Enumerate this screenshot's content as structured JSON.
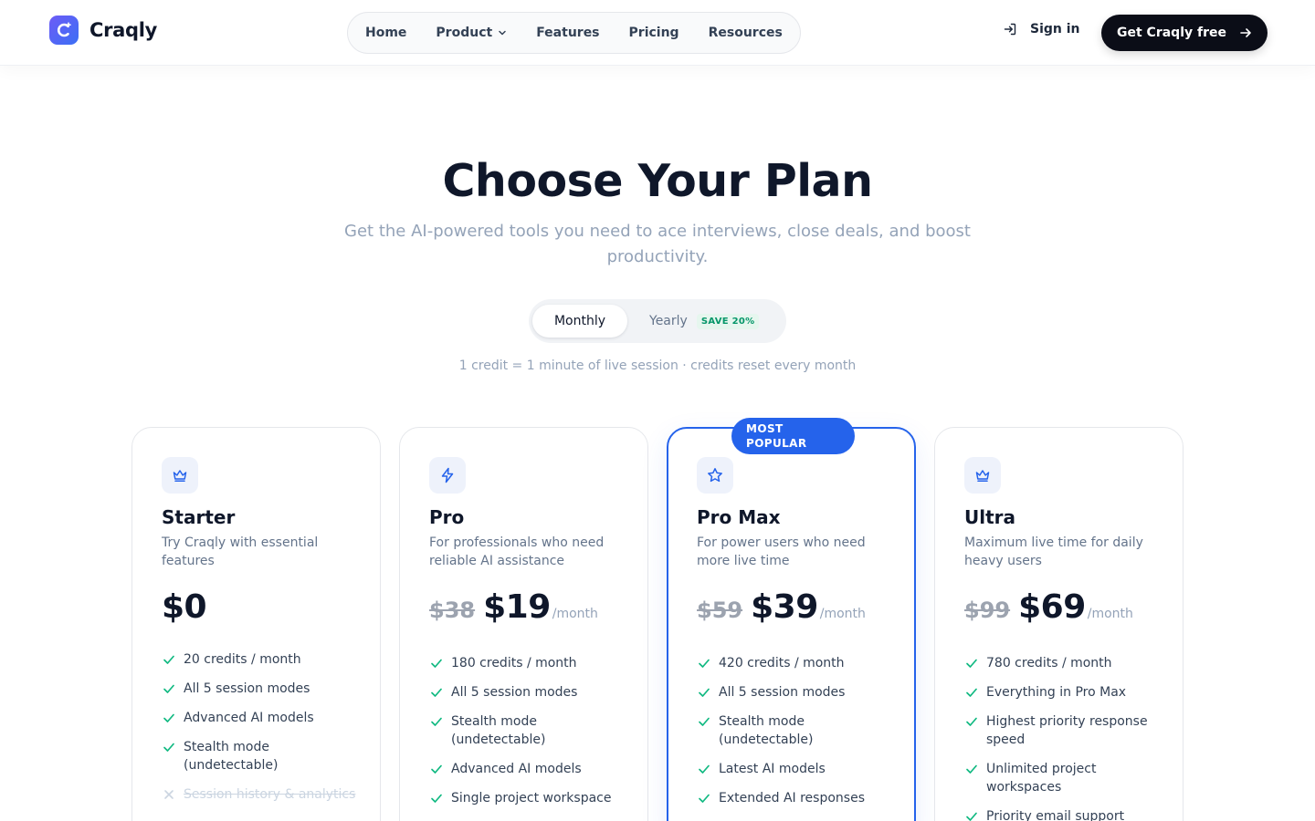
{
  "brand": {
    "name": "Craqly"
  },
  "nav": {
    "items": [
      {
        "label": "Home"
      },
      {
        "label": "Product"
      },
      {
        "label": "Features"
      },
      {
        "label": "Pricing"
      },
      {
        "label": "Resources"
      }
    ]
  },
  "header": {
    "signin_label": "Sign in",
    "cta_label": "Get Craqly free"
  },
  "hero": {
    "title": "Choose Your Plan",
    "subtitle": "Get the AI-powered tools you need to ace interviews, close deals, and boost productivity."
  },
  "billing": {
    "monthly_label": "Monthly",
    "yearly_label": "Yearly",
    "save_badge": "SAVE 20%",
    "selected": "Monthly"
  },
  "credit_note": "1 credit = 1 minute of live session · credits reset every month",
  "plans": [
    {
      "icon": "crown-icon",
      "name": "Starter",
      "description": "Try Craqly with essential features",
      "old_price": "",
      "price": "$0",
      "period": "",
      "features": [
        {
          "text": "20 credits / month",
          "included": true
        },
        {
          "text": "All 5 session modes",
          "included": true
        },
        {
          "text": "Advanced AI models",
          "included": true
        },
        {
          "text": "Stealth mode (undetectable)",
          "included": true
        },
        {
          "text": "Session history & analytics",
          "included": false
        }
      ]
    },
    {
      "icon": "lightning-icon",
      "name": "Pro",
      "description": "For professionals who need reliable AI assistance",
      "old_price": "$38",
      "price": "$19",
      "period": "/month",
      "features": [
        {
          "text": "180 credits / month",
          "included": true
        },
        {
          "text": "All 5 session modes",
          "included": true
        },
        {
          "text": "Stealth mode (undetectable)",
          "included": true
        },
        {
          "text": "Advanced AI models",
          "included": true
        },
        {
          "text": "Single project workspace",
          "included": true
        }
      ]
    },
    {
      "icon": "star-icon",
      "badge": "MOST POPULAR",
      "name": "Pro Max",
      "description": "For power users who need more live time",
      "old_price": "$59",
      "price": "$39",
      "period": "/month",
      "features": [
        {
          "text": "420 credits / month",
          "included": true
        },
        {
          "text": "All 5 session modes",
          "included": true
        },
        {
          "text": "Stealth mode (undetectable)",
          "included": true
        },
        {
          "text": "Latest AI models",
          "included": true
        },
        {
          "text": "Extended AI responses",
          "included": true
        }
      ]
    },
    {
      "icon": "crown-icon",
      "name": "Ultra",
      "description": "Maximum live time for daily heavy users",
      "old_price": "$99",
      "price": "$69",
      "period": "/month",
      "features": [
        {
          "text": "780 credits / month",
          "included": true
        },
        {
          "text": "Everything in Pro Max",
          "included": true
        },
        {
          "text": "Highest priority response speed",
          "included": true
        },
        {
          "text": "Unlimited project workspaces",
          "included": true
        },
        {
          "text": "Priority email support",
          "included": true
        }
      ]
    }
  ],
  "colors": {
    "accent": "#2563eb",
    "check": "#10b981",
    "dark": "#0b0d17"
  }
}
